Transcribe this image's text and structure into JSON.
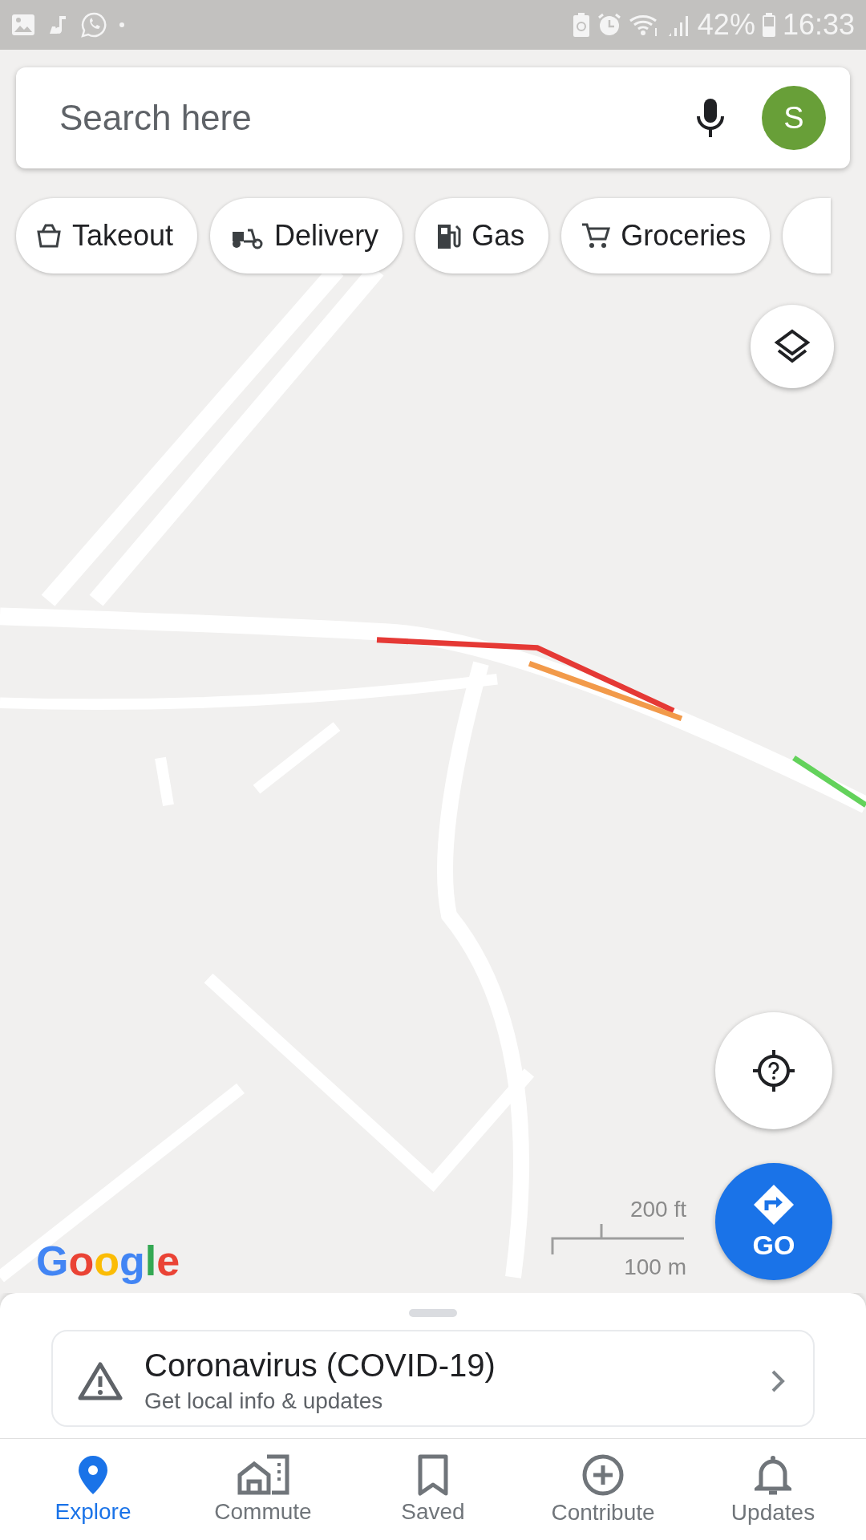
{
  "status_bar": {
    "battery": "42%",
    "time": "16:33"
  },
  "search": {
    "placeholder": "Search here",
    "avatar": "S"
  },
  "chips": [
    {
      "label": "Takeout",
      "kind": "takeout"
    },
    {
      "label": "Delivery",
      "kind": "delivery"
    },
    {
      "label": "Gas",
      "kind": "gas"
    },
    {
      "label": "Groceries",
      "kind": "groceries"
    }
  ],
  "map": {
    "kind": "picture",
    "logo": "Google",
    "scale": [
      "200 ft",
      "100 m"
    ],
    "go_label": "GO"
  },
  "card": {
    "title": "Coronavirus (COVID-19)",
    "subtitle": "Get local info & updates"
  },
  "nav": [
    {
      "label": "Explore",
      "kind": "explore",
      "selected": true
    },
    {
      "label": "Commute",
      "kind": "commute",
      "selected": false
    },
    {
      "label": "Saved",
      "kind": "saved",
      "selected": false
    },
    {
      "label": "Contribute",
      "kind": "contribute",
      "selected": false
    },
    {
      "label": "Updates",
      "kind": "updates",
      "selected": false
    }
  ]
}
